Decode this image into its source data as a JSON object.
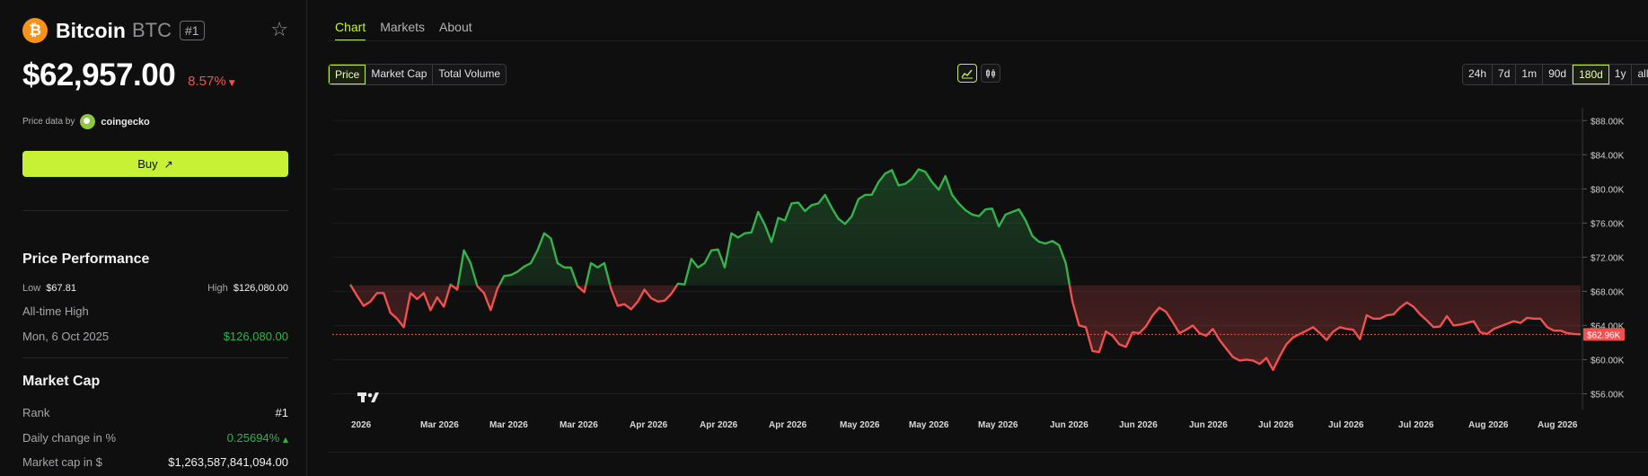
{
  "coin": {
    "name": "Bitcoin",
    "symbol": "BTC",
    "rank_badge": "#1",
    "logo_glyph": "₿"
  },
  "price": {
    "value": "$62,957.00",
    "change": "8.57%",
    "change_dir": "down"
  },
  "attribution": {
    "prefix": "Price data by",
    "source": "coingecko"
  },
  "buy": {
    "label": "Buy",
    "icon": "arrow-up-right-icon"
  },
  "performance": {
    "title": "Price Performance",
    "low_label": "Low",
    "low_value": "$67.81",
    "high_label": "High",
    "high_value": "$126,080.00",
    "ath_label": "All-time High",
    "ath_date": "Mon, 6 Oct 2025",
    "ath_value": "$126,080.00"
  },
  "market_cap": {
    "title": "Market Cap",
    "rank_label": "Rank",
    "rank_value": "#1",
    "daily_label": "Daily change in %",
    "daily_value": "0.25694%",
    "cap_label": "Market cap in $",
    "cap_value": "$1,263,587,841,094.00"
  },
  "tabs": [
    {
      "label": "Chart",
      "active": true
    },
    {
      "label": "Markets"
    },
    {
      "label": "About"
    }
  ],
  "metric_buttons": [
    {
      "label": "Price",
      "selected": true
    },
    {
      "label": "Market Cap"
    },
    {
      "label": "Total Volume"
    }
  ],
  "chart_type_icons": [
    "line-chart-icon",
    "candlestick-icon"
  ],
  "range_buttons": [
    {
      "label": "24h"
    },
    {
      "label": "7d"
    },
    {
      "label": "1m"
    },
    {
      "label": "90d"
    },
    {
      "label": "180d",
      "selected": true
    },
    {
      "label": "1y"
    },
    {
      "label": "all"
    }
  ],
  "colors": {
    "accent": "#c6f135",
    "up": "#35b24a",
    "down": "#f0514f",
    "bg": "#0f0f10"
  },
  "chart_data": {
    "type": "area",
    "baseline": 68.7,
    "current_label": "62.96K",
    "current_value": 62.96,
    "ylim": [
      55,
      89.5
    ],
    "y_ticks": [
      "$88.00K",
      "$84.00K",
      "$80.00K",
      "$76.00K",
      "$72.00K",
      "$68.00K",
      "$64.00K",
      "$60.00K",
      "$56.00K"
    ],
    "y_tick_values": [
      88,
      84,
      80,
      76,
      72,
      68,
      64,
      60,
      56
    ],
    "x_ticks": [
      "2026",
      "Mar 2026",
      "Mar 2026",
      "Mar 2026",
      "Apr 2026",
      "Apr 2026",
      "Apr 2026",
      "May 2026",
      "May 2026",
      "May 2026",
      "Jun 2026",
      "Jun 2026",
      "Jun 2026",
      "Jul 2026",
      "Jul 2026",
      "Jul 2026",
      "Aug 2026",
      "Aug 2026"
    ],
    "series": [
      {
        "values": [
          68.8,
          67.5,
          66.3,
          66.8,
          67.8,
          67.8,
          65.5,
          64.8,
          63.8,
          67.8,
          67.1,
          67.8,
          65.8,
          67.3,
          66.2,
          68.8,
          68.2,
          72.8,
          71.3,
          68.6,
          67.8,
          65.8,
          68.3,
          69.8,
          69.9,
          70.3,
          70.9,
          71.3,
          72.8,
          74.8,
          74.2,
          71.3,
          70.8,
          70.8,
          68.6,
          67.9,
          71.3,
          70.8,
          71.3,
          68.3,
          66.3,
          66.5,
          65.9,
          66.8,
          68.2,
          67.2,
          66.8,
          66.9,
          67.7,
          68.9,
          68.8,
          71.8,
          70.8,
          71.3,
          72.8,
          72.9,
          70.8,
          74.8,
          74.3,
          74.8,
          74.9,
          77.3,
          75.8,
          73.8,
          76.6,
          76.3,
          78.3,
          78.4,
          77.4,
          78.1,
          78.3,
          79.3,
          77.8,
          76.5,
          75.9,
          76.8,
          78.8,
          79.3,
          79.3,
          80.8,
          81.8,
          82.2,
          80.4,
          80.6,
          81.2,
          82.3,
          82.0,
          80.8,
          79.9,
          81.5,
          79.3,
          78.3,
          77.5,
          77.0,
          76.8,
          77.6,
          77.7,
          75.6,
          77.0,
          77.3,
          77.6,
          76.3,
          74.5,
          73.8,
          73.6,
          73.9,
          73.4,
          71.3,
          66.8,
          64.0,
          63.8,
          61.0,
          60.9,
          63.3,
          62.8,
          61.8,
          61.5,
          63.2,
          63.1,
          63.9,
          65.2,
          66.1,
          65.6,
          64.4,
          63.1,
          63.5,
          64.0,
          63.1,
          62.8,
          63.6,
          62.3,
          61.3,
          60.3,
          59.9,
          60.0,
          59.9,
          59.5,
          60.2,
          58.8,
          60.4,
          61.8,
          62.6,
          63.0,
          63.4,
          63.8,
          63.1,
          62.3,
          63.3,
          63.8,
          63.6,
          63.5,
          62.4,
          65.2,
          64.8,
          64.8,
          65.2,
          65.3,
          66.1,
          66.7,
          66.2,
          65.3,
          64.6,
          63.8,
          63.9,
          65.1,
          64.0,
          64.1,
          64.3,
          64.5,
          63.2,
          63.0,
          63.6,
          63.9,
          64.2,
          64.5,
          64.3,
          64.9,
          64.8,
          64.8,
          63.8,
          63.4,
          63.4,
          63.1,
          63.0,
          62.96
        ]
      }
    ]
  }
}
